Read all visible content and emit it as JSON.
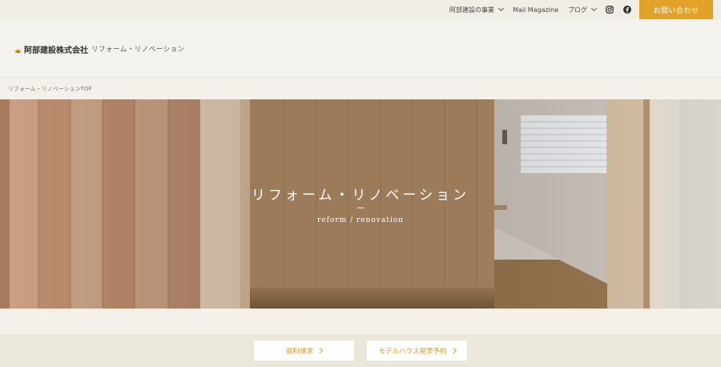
{
  "topnav": {
    "business_label": "阿部建設の事業",
    "magazine_label": "Mail Magazine",
    "blog_label": "ブログ",
    "contact_label": "お問い合わせ"
  },
  "header": {
    "logo_text": "阿部建設株式会社",
    "page_subtitle": "リフォーム・リノベーション"
  },
  "breadcrumb": "リフォーム・リノベーションTOP",
  "hero": {
    "title": "リフォーム・リノベーション",
    "subtitle": "reform / renovation"
  },
  "actions": {
    "request_label": "資料請求",
    "model_house_label": "モデルハウス見学予約"
  },
  "colors": {
    "accent": "#e2a228",
    "background": "#f3f1ea"
  },
  "icons": [
    "chevron-down-icon",
    "instagram-icon",
    "facebook-icon",
    "chevron-right-icon",
    "logo-mark-icon"
  ]
}
